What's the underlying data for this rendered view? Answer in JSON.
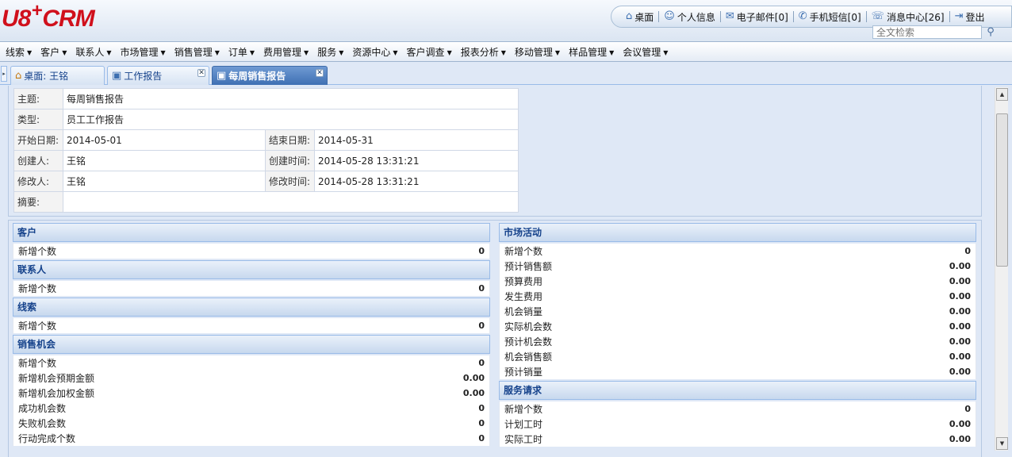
{
  "logo": {
    "part1": "U8",
    "plus": "+",
    "part2": "CRM"
  },
  "toplinks": [
    {
      "icon": "home-icon",
      "glyph": "⌂",
      "label": "桌面"
    },
    {
      "icon": "user-icon",
      "glyph": "☺",
      "label": "个人信息"
    },
    {
      "icon": "mail-icon",
      "glyph": "✉",
      "label": "电子邮件[0]"
    },
    {
      "icon": "sms-icon",
      "glyph": "✆",
      "label": "手机短信[0]"
    },
    {
      "icon": "message-icon",
      "glyph": "☏",
      "label": "消息中心[26]"
    },
    {
      "icon": "logout-icon",
      "glyph": "⇥",
      "label": "登出"
    }
  ],
  "search": {
    "placeholder": "全文检索",
    "icon": "search-icon"
  },
  "menu": [
    "线索",
    "客户",
    "联系人",
    "市场管理",
    "销售管理",
    "订单",
    "费用管理",
    "服务",
    "资源中心",
    "客户调查",
    "报表分析",
    "移动管理",
    "样品管理",
    "会议管理"
  ],
  "tabs": [
    {
      "label": "桌面: 王铭",
      "icon": "home-icon",
      "glyph": "⌂",
      "closable": false,
      "active": false
    },
    {
      "label": "工作报告",
      "icon": "report-icon",
      "glyph": "▣",
      "closable": true,
      "active": false
    },
    {
      "label": "每周销售报告",
      "icon": "report-icon",
      "glyph": "▣",
      "closable": true,
      "active": true
    }
  ],
  "info": {
    "subject_label": "主题:",
    "subject": "每周销售报告",
    "type_label": "类型:",
    "type": "员工工作报告",
    "start_label": "开始日期:",
    "start": "2014-05-01",
    "end_label": "结束日期:",
    "end": "2014-05-31",
    "creator_label": "创建人:",
    "creator": "王铭",
    "created_label": "创建时间:",
    "created": "2014-05-28 13:31:21",
    "modifier_label": "修改人:",
    "modifier": "王铭",
    "modified_label": "修改时间:",
    "modified": "2014-05-28 13:31:21",
    "summary_label": "摘要:",
    "summary": ""
  },
  "left_sections": [
    {
      "title": "客户",
      "rows": [
        {
          "label": "新增个数",
          "value": "0"
        }
      ]
    },
    {
      "title": "联系人",
      "rows": [
        {
          "label": "新增个数",
          "value": "0"
        }
      ]
    },
    {
      "title": "线索",
      "rows": [
        {
          "label": "新增个数",
          "value": "0"
        }
      ]
    },
    {
      "title": "销售机会",
      "rows": [
        {
          "label": "新增个数",
          "value": "0"
        },
        {
          "label": "新增机会预期金额",
          "value": "0.00"
        },
        {
          "label": "新增机会加权金额",
          "value": "0.00"
        },
        {
          "label": "成功机会数",
          "value": "0"
        },
        {
          "label": "失败机会数",
          "value": "0"
        },
        {
          "label": "行动完成个数",
          "value": "0"
        }
      ]
    }
  ],
  "right_sections": [
    {
      "title": "市场活动",
      "rows": [
        {
          "label": "新增个数",
          "value": "0"
        },
        {
          "label": "预计销售额",
          "value": "0.00"
        },
        {
          "label": "预算费用",
          "value": "0.00"
        },
        {
          "label": "发生费用",
          "value": "0.00"
        },
        {
          "label": "机会销量",
          "value": "0.00"
        },
        {
          "label": "实际机会数",
          "value": "0.00"
        },
        {
          "label": "预计机会数",
          "value": "0.00"
        },
        {
          "label": "机会销售额",
          "value": "0.00"
        },
        {
          "label": "预计销量",
          "value": "0.00"
        }
      ]
    },
    {
      "title": "服务请求",
      "rows": [
        {
          "label": "新增个数",
          "value": "0"
        },
        {
          "label": "计划工时",
          "value": "0.00"
        },
        {
          "label": "实际工时",
          "value": "0.00"
        }
      ]
    }
  ]
}
